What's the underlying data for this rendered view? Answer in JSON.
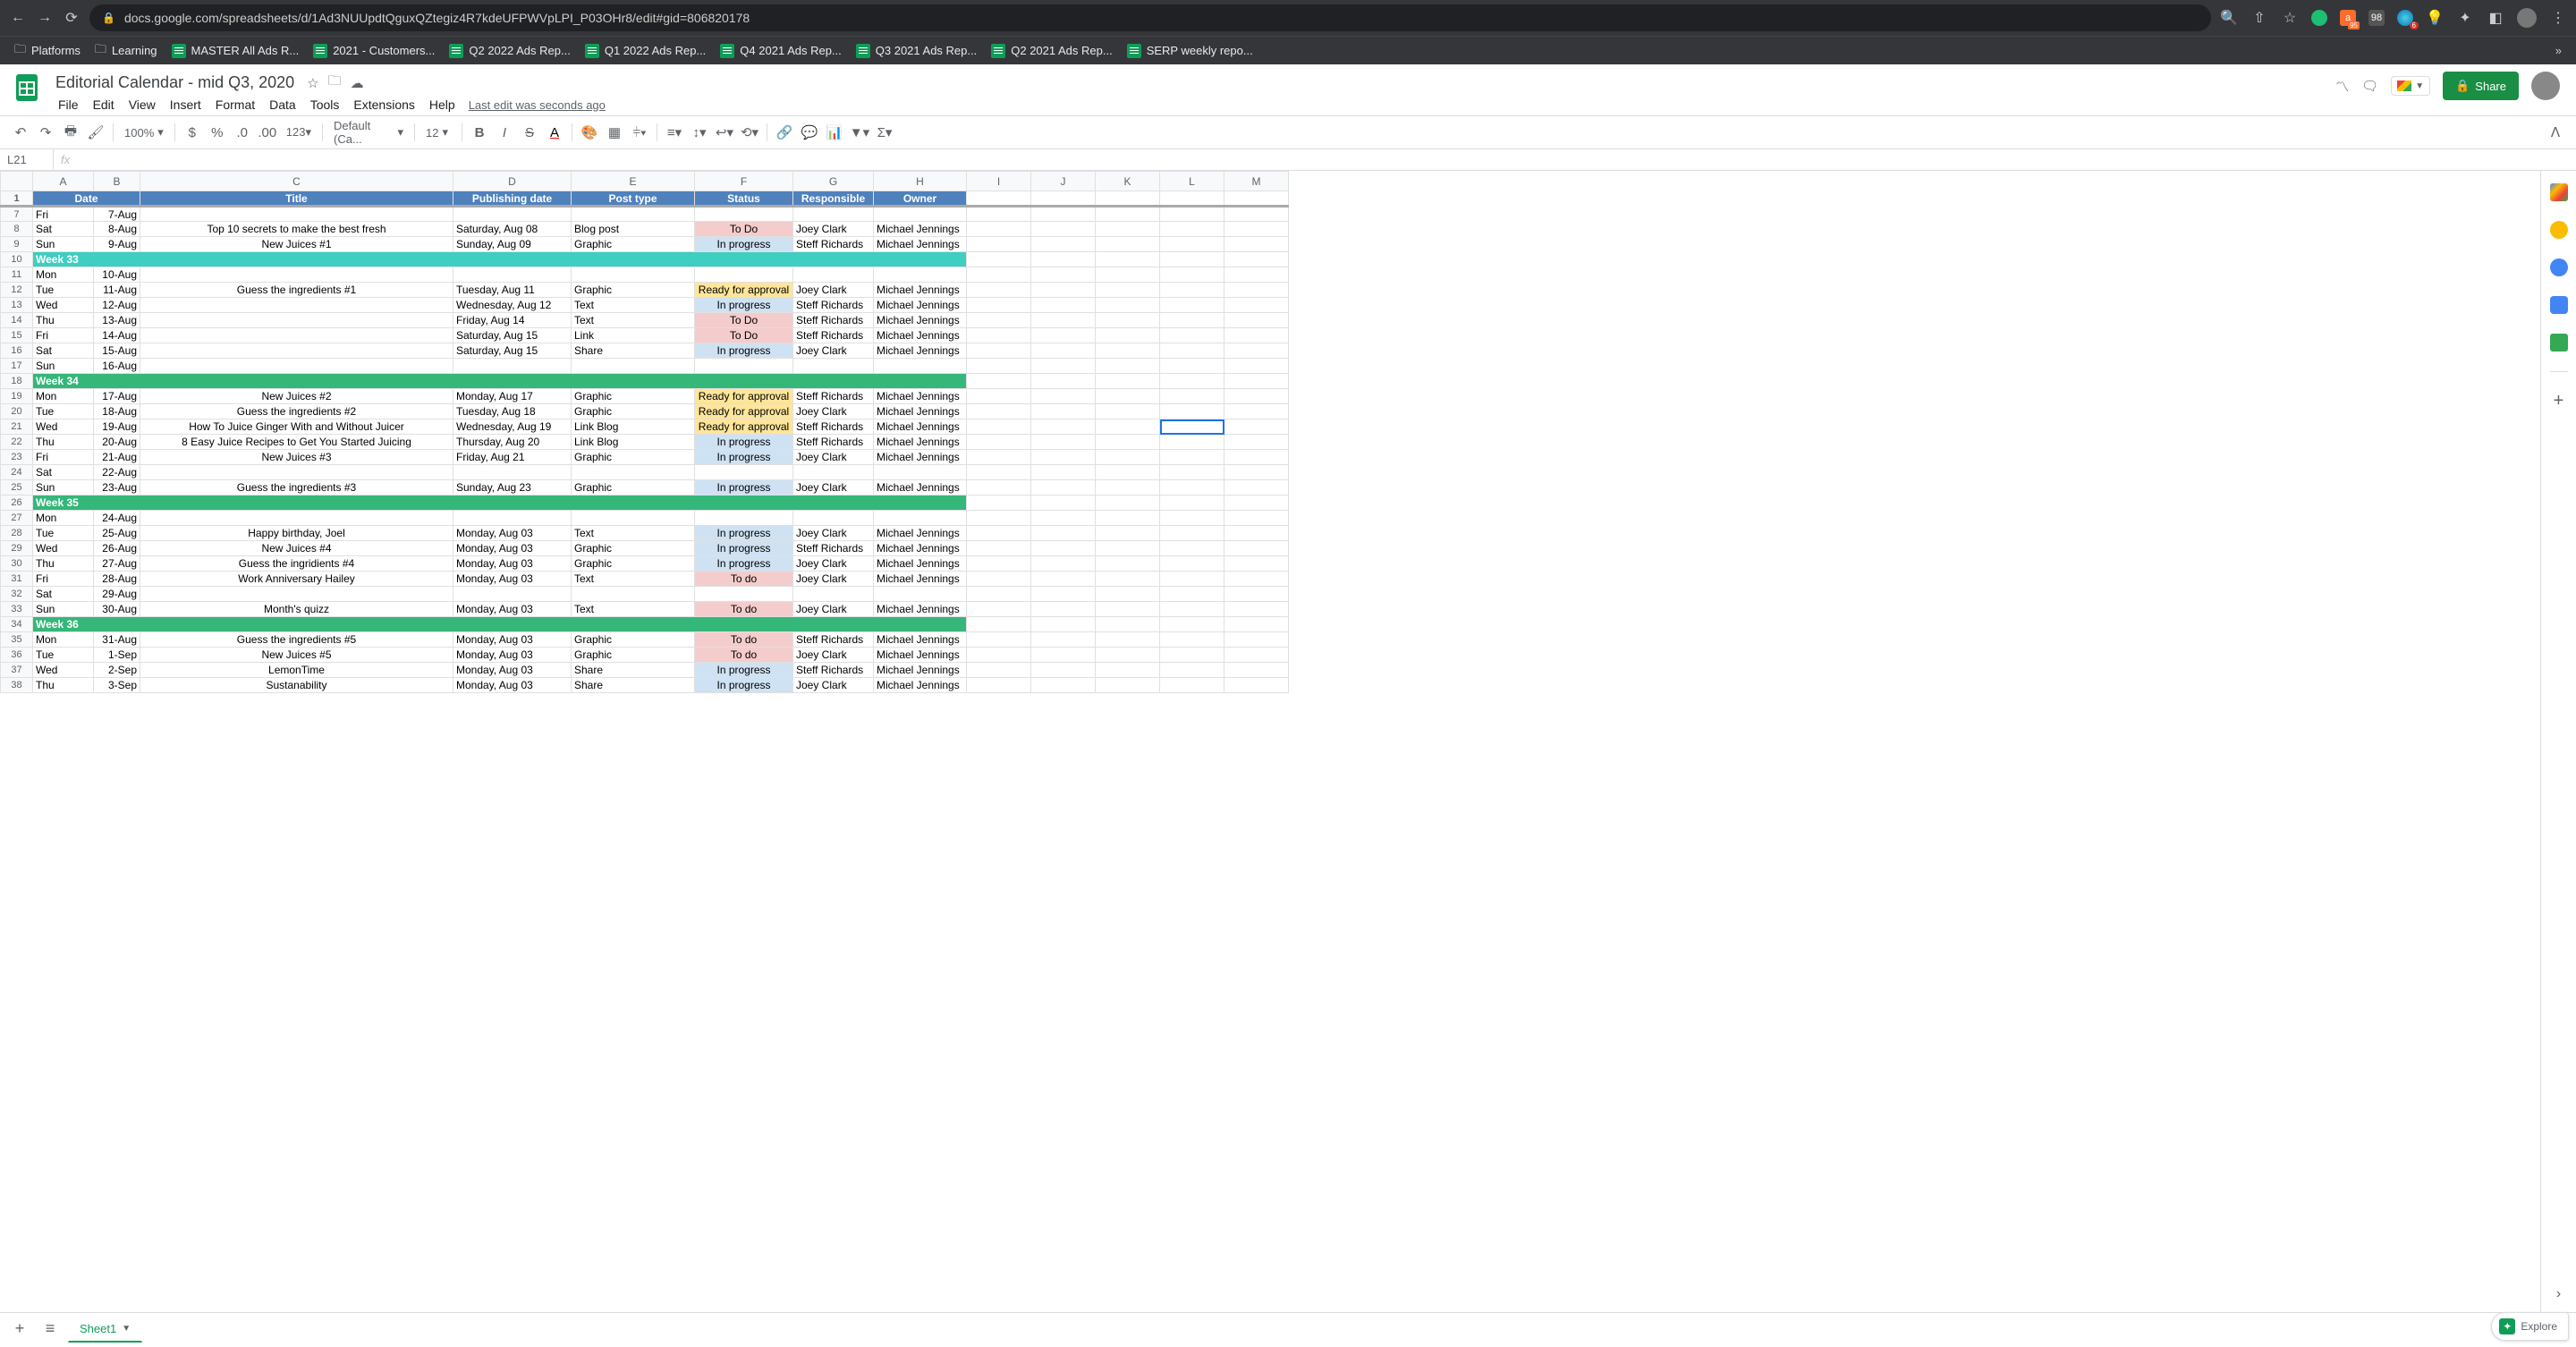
{
  "browser": {
    "url": "docs.google.com/spreadsheets/d/1Ad3NUUpdtQguxQZtegiz4R7kdeUFPWVpLPI_P03OHr8/edit#gid=806820178",
    "bookmarks": [
      {
        "label": "Platforms",
        "icon": "folder"
      },
      {
        "label": "Learning",
        "icon": "folder"
      },
      {
        "label": "MASTER All Ads R...",
        "icon": "sheet"
      },
      {
        "label": "2021 - Customers...",
        "icon": "sheet"
      },
      {
        "label": "Q2 2022 Ads Rep...",
        "icon": "sheet"
      },
      {
        "label": "Q1 2022 Ads Rep...",
        "icon": "sheet"
      },
      {
        "label": "Q4 2021 Ads Rep...",
        "icon": "sheet"
      },
      {
        "label": "Q3 2021 Ads Rep...",
        "icon": "sheet"
      },
      {
        "label": "Q2 2021 Ads Rep...",
        "icon": "sheet"
      },
      {
        "label": "SERP weekly repo...",
        "icon": "sheet"
      }
    ],
    "overflow": "»",
    "ext_badge": "95",
    "cal_badge": "6",
    "rank_badge": "98"
  },
  "doc": {
    "title": "Editorial Calendar - mid Q3, 2020",
    "menus": [
      "File",
      "Edit",
      "View",
      "Insert",
      "Format",
      "Data",
      "Tools",
      "Extensions",
      "Help"
    ],
    "last_edit": "Last edit was seconds ago",
    "share": "Share"
  },
  "toolbar": {
    "zoom": "100%",
    "font": "Default (Ca...",
    "size": "12"
  },
  "cell": {
    "ref": "L21"
  },
  "columns": [
    "A",
    "B",
    "C",
    "D",
    "E",
    "F",
    "G",
    "H",
    "I",
    "J",
    "K",
    "L",
    "M"
  ],
  "headers": [
    "Date",
    "",
    "Title",
    "Publishing date",
    "Post type",
    "Status",
    "Responsible",
    "Owner"
  ],
  "rows": [
    {
      "n": 7,
      "cells": [
        "Fri",
        "7-Aug",
        "",
        "",
        "",
        "",
        "",
        ""
      ]
    },
    {
      "n": 8,
      "cells": [
        "Sat",
        "8-Aug",
        "Top 10 secrets to make the best fresh",
        "Saturday, Aug 08",
        "Blog post",
        "To Do",
        "Joey Clark",
        "Michael Jennings"
      ]
    },
    {
      "n": 9,
      "cells": [
        "Sun",
        "9-Aug",
        "New Juices #1",
        "Sunday, Aug 09",
        "Graphic",
        "In progress",
        "Steff Richards",
        "Michael Jennings"
      ]
    },
    {
      "n": 10,
      "week": "Week 33",
      "color": "week33"
    },
    {
      "n": 11,
      "cells": [
        "Mon",
        "10-Aug",
        "",
        "",
        "",
        "",
        "",
        ""
      ]
    },
    {
      "n": 12,
      "cells": [
        "Tue",
        "11-Aug",
        "Guess the ingredients #1",
        "Tuesday, Aug 11",
        "Graphic",
        "Ready for approval",
        "Joey Clark",
        "Michael Jennings"
      ]
    },
    {
      "n": 13,
      "cells": [
        "Wed",
        "12-Aug",
        "",
        "Wednesday, Aug 12",
        "Text",
        "In progress",
        "Steff Richards",
        "Michael Jennings"
      ]
    },
    {
      "n": 14,
      "cells": [
        "Thu",
        "13-Aug",
        "",
        "Friday, Aug 14",
        "Text",
        "To Do",
        "Steff Richards",
        "Michael Jennings"
      ]
    },
    {
      "n": 15,
      "cells": [
        "Fri",
        "14-Aug",
        "",
        "Saturday, Aug 15",
        "Link",
        "To Do",
        "Steff Richards",
        "Michael Jennings"
      ]
    },
    {
      "n": 16,
      "cells": [
        "Sat",
        "15-Aug",
        "",
        "Saturday, Aug 15",
        "Share",
        "In progress",
        "Joey Clark",
        "Michael Jennings"
      ]
    },
    {
      "n": 17,
      "cells": [
        "Sun",
        "16-Aug",
        "",
        "",
        "",
        "",
        "",
        ""
      ]
    },
    {
      "n": 18,
      "week": "Week 34"
    },
    {
      "n": 19,
      "cells": [
        "Mon",
        "17-Aug",
        "New Juices #2",
        "Monday, Aug 17",
        "Graphic",
        "Ready for approval",
        "Steff Richards",
        "Michael Jennings"
      ]
    },
    {
      "n": 20,
      "cells": [
        "Tue",
        "18-Aug",
        "Guess the ingredients #2",
        "Tuesday, Aug 18",
        "Graphic",
        "Ready for approval",
        "Joey Clark",
        "Michael Jennings"
      ]
    },
    {
      "n": 21,
      "cells": [
        "Wed",
        "19-Aug",
        "How To Juice Ginger With and Without Juicer",
        "Wednesday, Aug 19",
        "Link Blog",
        "Ready for approval",
        "Steff Richards",
        "Michael Jennings"
      ]
    },
    {
      "n": 22,
      "cells": [
        "Thu",
        "20-Aug",
        "8 Easy Juice Recipes to Get You Started Juicing",
        "Thursday, Aug 20",
        "Link Blog",
        "In progress",
        "Steff Richards",
        "Michael Jennings"
      ]
    },
    {
      "n": 23,
      "cells": [
        "Fri",
        "21-Aug",
        "New Juices #3",
        "Friday, Aug 21",
        "Graphic",
        "In progress",
        "Joey Clark",
        "Michael Jennings"
      ]
    },
    {
      "n": 24,
      "cells": [
        "Sat",
        "22-Aug",
        "",
        "",
        "",
        "",
        "",
        ""
      ]
    },
    {
      "n": 25,
      "cells": [
        "Sun",
        "23-Aug",
        "Guess the ingredients #3",
        "Sunday, Aug 23",
        "Graphic",
        "In progress",
        "Joey Clark",
        "Michael Jennings"
      ]
    },
    {
      "n": 26,
      "week": "Week 35"
    },
    {
      "n": 27,
      "cells": [
        "Mon",
        "24-Aug",
        "",
        "",
        "",
        "",
        "",
        ""
      ]
    },
    {
      "n": 28,
      "cells": [
        "Tue",
        "25-Aug",
        "Happy birthday, Joel",
        "Monday, Aug 03",
        "Text",
        "In progress",
        "Joey Clark",
        "Michael Jennings"
      ]
    },
    {
      "n": 29,
      "cells": [
        "Wed",
        "26-Aug",
        "New Juices #4",
        "Monday, Aug 03",
        "Graphic",
        "In progress",
        "Steff Richards",
        "Michael Jennings"
      ]
    },
    {
      "n": 30,
      "cells": [
        "Thu",
        "27-Aug",
        "Guess the ingridients #4",
        "Monday, Aug 03",
        "Graphic",
        "In progress",
        "Joey Clark",
        "Michael Jennings"
      ]
    },
    {
      "n": 31,
      "cells": [
        "Fri",
        "28-Aug",
        "Work Anniversary Hailey",
        "Monday, Aug 03",
        "Text",
        "To do",
        "Joey Clark",
        "Michael Jennings"
      ]
    },
    {
      "n": 32,
      "cells": [
        "Sat",
        "29-Aug",
        "",
        "",
        "",
        "",
        "",
        ""
      ]
    },
    {
      "n": 33,
      "cells": [
        "Sun",
        "30-Aug",
        "Month's quizz",
        "Monday, Aug 03",
        "Text",
        "To do",
        "Joey Clark",
        "Michael Jennings"
      ]
    },
    {
      "n": 34,
      "week": "Week 36"
    },
    {
      "n": 35,
      "cells": [
        "Mon",
        "31-Aug",
        "Guess the ingredients #5",
        "Monday, Aug 03",
        "Graphic",
        "To do",
        "Steff Richards",
        "Michael Jennings"
      ]
    },
    {
      "n": 36,
      "cells": [
        "Tue",
        "1-Sep",
        "New Juices #5",
        "Monday, Aug 03",
        "Graphic",
        "To do",
        "Joey Clark",
        "Michael Jennings"
      ]
    },
    {
      "n": 37,
      "cells": [
        "Wed",
        "2-Sep",
        "LemonTime",
        "Monday, Aug 03",
        "Share",
        "In progress",
        "Steff Richards",
        "Michael Jennings"
      ]
    },
    {
      "n": 38,
      "cells": [
        "Thu",
        "3-Sep",
        "Sustanability",
        "Monday, Aug 03",
        "Share",
        "In progress",
        "Joey Clark",
        "Michael Jennings"
      ]
    }
  ],
  "tabs": {
    "sheet1": "Sheet1",
    "explore": "Explore"
  }
}
